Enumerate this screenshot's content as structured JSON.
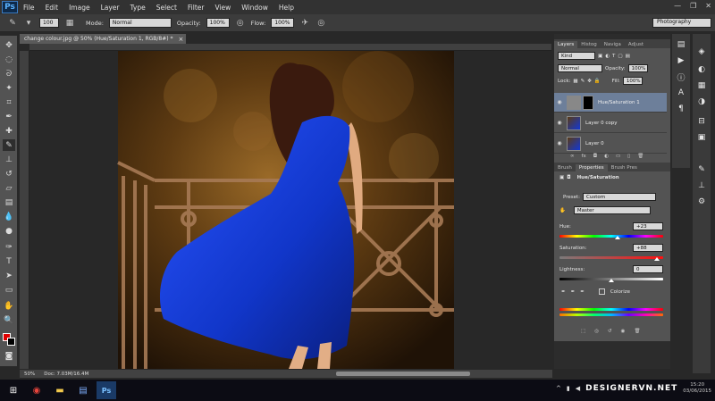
{
  "app": {
    "logo": "Ps"
  },
  "menu": [
    "File",
    "Edit",
    "Image",
    "Layer",
    "Type",
    "Select",
    "Filter",
    "View",
    "Window",
    "Help"
  ],
  "window_controls": {
    "minimize": "—",
    "restore": "❐",
    "close": "✕"
  },
  "options_bar": {
    "brush_size": "100",
    "mode_label": "Mode:",
    "mode_value": "Normal",
    "opacity_label": "Opacity:",
    "opacity_value": "100%",
    "flow_label": "Flow:",
    "flow_value": "100%",
    "workspace": "Photography"
  },
  "document": {
    "tab_title": "change colour.jpg @ 50% (Hue/Saturation 1, RGB/8#) *",
    "close_glyph": "×",
    "zoom": "50%",
    "doc_info": "Doc: 7.03M/16.4M"
  },
  "colors": {
    "foreground": "#e00000",
    "background": "#000000",
    "dress_blue": "#1238d6"
  },
  "layers_panel": {
    "tabs": [
      "Layers",
      "Histog",
      "Naviga",
      "Adjust"
    ],
    "kind": "Kind",
    "blend_mode": "Normal",
    "opacity_label": "Opacity:",
    "opacity_value": "100%",
    "lock_label": "Lock:",
    "fill_label": "Fill:",
    "fill_value": "100%",
    "layers": [
      {
        "name": "Hue/Saturation 1",
        "selected": true
      },
      {
        "name": "Layer 0 copy",
        "selected": false
      },
      {
        "name": "Layer 0",
        "selected": false
      }
    ]
  },
  "properties_panel": {
    "tabs": [
      "Brush",
      "Properties",
      "Brush Pres"
    ],
    "title": "Hue/Saturation",
    "preset_label": "Preset:",
    "preset_value": "Custom",
    "channel": "Master",
    "hue_label": "Hue:",
    "hue_value": "+23",
    "hue_fraction": 0.56,
    "saturation_label": "Saturation:",
    "saturation_value": "+88",
    "saturation_fraction": 0.94,
    "lightness_label": "Lightness:",
    "lightness_value": "0",
    "lightness_fraction": 0.5,
    "colorize_label": "Colorize"
  },
  "taskbar": {
    "apps": [
      "windows-logo",
      "chrome",
      "file-explorer",
      "ps"
    ],
    "watermark": "DESIGNERVN.NET",
    "clock_time": "15:20",
    "clock_date": "03/06/2015"
  }
}
